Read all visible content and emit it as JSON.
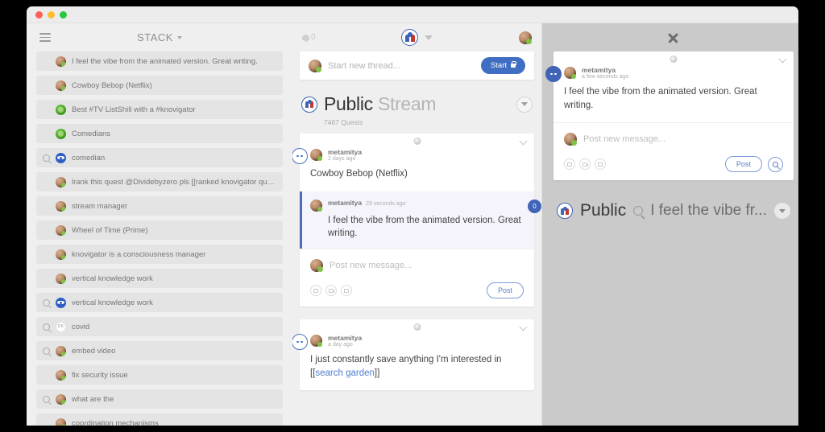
{
  "window": {
    "controls": [
      "close",
      "minimize",
      "maximize"
    ]
  },
  "sidebar": {
    "menu_icon": "hamburger-icon",
    "title": "STACK",
    "items": [
      {
        "label": "I feel the vibe from the animated version. Great writing.",
        "avatar": "photo",
        "search": false
      },
      {
        "label": "Cowboy Bebop (Netflix)",
        "avatar": "photo",
        "search": false
      },
      {
        "label": "Best #TV ListShill with a #knovigator",
        "avatar": "green",
        "search": false
      },
      {
        "label": "Comedians",
        "avatar": "green",
        "search": false
      },
      {
        "label": "comedian",
        "avatar": "eye",
        "search": true
      },
      {
        "label": "lrank this quest @Dividebyzero pls [[ranked knovigator quest]]",
        "avatar": "photo",
        "search": false
      },
      {
        "label": "stream manager",
        "avatar": "photo",
        "search": false
      },
      {
        "label": "Wheel of Time (Prime)",
        "avatar": "photo",
        "search": false
      },
      {
        "label": "knovigator is a consciousness manager",
        "avatar": "photo",
        "search": false
      },
      {
        "label": "vertical knowledge work",
        "avatar": "photo",
        "search": false
      },
      {
        "label": "vertical knowledge work",
        "avatar": "eye",
        "search": true
      },
      {
        "label": "covid",
        "avatar": "initials",
        "avatar_text": "DK",
        "search": true
      },
      {
        "label": "embed video",
        "avatar": "photo",
        "search": true
      },
      {
        "label": "fix security issue",
        "avatar": "photo",
        "search": false
      },
      {
        "label": "what are the",
        "avatar": "photo",
        "search": true
      },
      {
        "label": "coordination mechanisms",
        "avatar": "photo",
        "search": false
      }
    ]
  },
  "center": {
    "bell_icon": "bell-icon",
    "bell_count": "0",
    "logo_icon": "brand-logo-icon",
    "dropdown_icon": "caret-down-icon",
    "avatar_icon": "user-avatar",
    "new_thread": {
      "placeholder": "Start new thread...",
      "start_label": "Start",
      "lock_icon": "lock-icon"
    },
    "stream": {
      "name": "Public",
      "suffix": "Stream",
      "count": "7467 Quests",
      "caret_icon": "caret-down-icon"
    },
    "threads": [
      {
        "globe_icon": "globe-icon",
        "collapse_icon": "chevron-down-icon",
        "dots_icon": "more-options-icon",
        "author": "metamitya",
        "time": "2 days ago",
        "text": "Cowboy Bebop (Netflix)"
      }
    ],
    "highlighted_message": {
      "author": "metamitya",
      "time": "29 seconds ago",
      "text": "I feel the vibe from the animated version. Great writing.",
      "badge": "0"
    },
    "post_composer": {
      "placeholder": "Post new message...",
      "post_label": "Post",
      "icons": [
        "image-icon",
        "video-icon",
        "comment-icon"
      ]
    },
    "bottom_thread": {
      "globe_icon": "globe-icon",
      "collapse_icon": "chevron-down-icon",
      "dots_icon": "more-options-icon",
      "author": "metamitya",
      "time": "a day ago",
      "text_before": "I just constantly save anything I'm interested in [[",
      "text_link": "search garden",
      "text_after": "]]"
    }
  },
  "right_panel": {
    "close_icon": "close-icon",
    "dots_icon": "more-options-icon",
    "globe_icon": "globe-icon",
    "collapse_icon": "chevron-down-icon",
    "message": {
      "author": "metamitya",
      "time": "a few seconds ago",
      "text": "I feel the vibe from the animated version. Great writing."
    },
    "post_composer": {
      "placeholder": "Post new message...",
      "post_label": "Post",
      "search_icon": "search-icon",
      "icons": [
        "image-icon",
        "video-icon",
        "comment-icon"
      ]
    },
    "bottom_bar": {
      "title": "Public",
      "search_icon": "search-icon",
      "query": "I feel the vibe fr...",
      "caret_icon": "caret-down-icon"
    }
  },
  "colors": {
    "accent_blue": "#3f63b5",
    "highlight_bg": "#f5f4fc",
    "highlight_border": "#4a6fb5",
    "panel_bg": "#efefef",
    "overlay_bg": "#cacaca"
  }
}
